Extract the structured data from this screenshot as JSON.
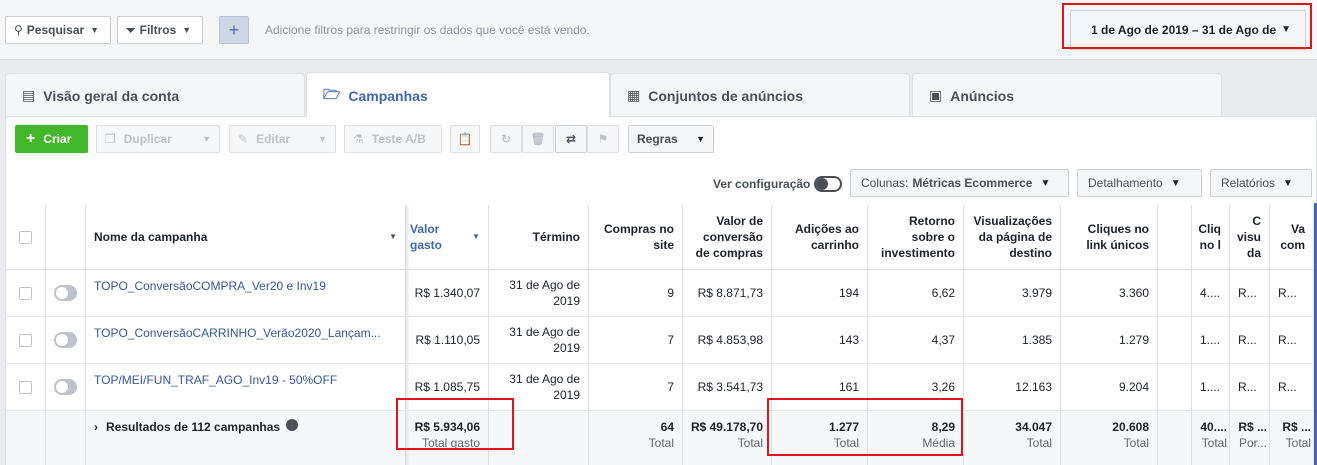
{
  "topbar": {
    "search_label": "Pesquisar",
    "filters_label": "Filtros",
    "add_label": "+",
    "hint": "Adicione filtros para restringir os dados que você está vendo.",
    "date_range": "1 de Ago de 2019 – 31 de Ago de"
  },
  "tabs": [
    {
      "label": "Visão geral da conta",
      "icon": "account-overview-icon"
    },
    {
      "label": "Campanhas",
      "icon": "folder-check-icon"
    },
    {
      "label": "Conjuntos de anúncios",
      "icon": "grid-icon"
    },
    {
      "label": "Anúncios",
      "icon": "ad-icon"
    }
  ],
  "toolbar": {
    "create": "Criar",
    "duplicate": "Duplicar",
    "edit": "Editar",
    "ab_test": "Teste A/B",
    "rules": "Regras",
    "view_config": "Ver configuração",
    "columns_prefix": "Colunas:",
    "columns_value": "Métricas Ecommerce",
    "breakdown": "Detalhamento",
    "reports": "Relatórios"
  },
  "table": {
    "headers": {
      "name": "Nome da campanha",
      "spend": "Valor gasto",
      "end": "Término",
      "purchases": "Compras no site",
      "conv_value": "Valor de conversão de compras",
      "add_to_cart": "Adições ao carrinho",
      "roas": "Retorno sobre o investimento",
      "landing_views": "Visualizações da página de destino",
      "unique_clicks": "Cliques no link únicos",
      "col_a": "Cliq no l",
      "col_b": "C visu da",
      "col_c": "Va com"
    },
    "rows": [
      {
        "name": "TOPO_ConversãoCOMPRA_Ver20 e Inv19",
        "spend": "R$ 1.340,07",
        "end": "31 de Ago de 2019",
        "purchases": "9",
        "conv_value": "R$ 8.871,73",
        "add_to_cart": "194",
        "roas": "6,62",
        "landing_views": "3.979",
        "unique_clicks": "3.360",
        "col_a": "4....",
        "col_b": "R...",
        "col_c": "R..."
      },
      {
        "name": "TOPO_ConversãoCARRINHO_Verão2020_Lançam...",
        "spend": "R$ 1.110,05",
        "end": "31 de Ago de 2019",
        "purchases": "7",
        "conv_value": "R$ 4.853,98",
        "add_to_cart": "143",
        "roas": "4,37",
        "landing_views": "1.385",
        "unique_clicks": "1.279",
        "col_a": "1....",
        "col_b": "R...",
        "col_c": "R..."
      },
      {
        "name": "TOP/MEI/FUN_TRAF_AGO_Inv19 - 50%OFF",
        "spend": "R$ 1.085,75",
        "end": "31 de Ago de 2019",
        "purchases": "7",
        "conv_value": "R$ 3.541,73",
        "add_to_cart": "161",
        "roas": "3,26",
        "landing_views": "12.163",
        "unique_clicks": "9.204",
        "col_a": "1....",
        "col_b": "R...",
        "col_c": "R..."
      }
    ],
    "totals": {
      "label": "Resultados de 112 campanhas",
      "spend": "R$ 5.934,06",
      "spend_sub": "Total gasto",
      "purchases": "64",
      "purchases_sub": "Total",
      "conv_value": "R$ 49.178,70",
      "conv_value_sub": "Total",
      "add_to_cart": "1.277",
      "add_to_cart_sub": "Total",
      "roas": "8,29",
      "roas_sub": "Média",
      "landing_views": "34.047",
      "landing_views_sub": "Total",
      "unique_clicks": "20.608",
      "unique_clicks_sub": "Total",
      "col_a": "40....",
      "col_a_sub": "Total",
      "col_b": "R$ ...",
      "col_b_sub": "Por...",
      "col_c": "R$ ...",
      "col_c_sub": "Total"
    }
  },
  "colors": {
    "accent": "#4267b2",
    "create": "#42b72a",
    "highlight": "#e0141e",
    "link": "#365899"
  }
}
